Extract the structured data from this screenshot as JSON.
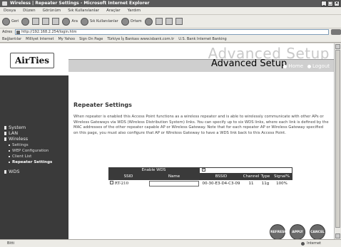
{
  "browser": {
    "title": "Wireless | Repeater Settings - Microsoft Internet Explorer",
    "menu": [
      "Dosya",
      "Düzen",
      "Görünüm",
      "Sık Kullanılanlar",
      "Araçlar",
      "Yardım"
    ],
    "toolbar": {
      "back": "Geri",
      "search": "Ara",
      "favorites": "Sık Kullanılanlar",
      "media": "Ortam"
    },
    "address_label": "Adres",
    "address": "http://192.168.2.254/login.htm",
    "links_label": "Bağlantılar",
    "links": [
      "Milliyet Internet",
      "My Yahoo",
      "Sign On Page",
      "Türkiye İş Bankası  www.isbank.com.tr",
      "U.S. Bank Internet Banking"
    ],
    "status_left": "Bitti",
    "status_right": "Internet"
  },
  "header": {
    "logo": "AirTies",
    "bg_text": "Advanced Setup",
    "title": "Advanced Setup",
    "home": "Home",
    "logout": "Logout"
  },
  "sidebar": {
    "groups": [
      "System",
      "LAN",
      "Wireless"
    ],
    "sub_items": [
      "Settings",
      "WEP Configuration",
      "Client List",
      "Repeater Settings"
    ],
    "extra": "WDS"
  },
  "content": {
    "title": "Repeater Settings",
    "description": "When repeater is enabled this Access Point functions as a wireless repeater and is able to wirelessly communicate with other APs or Wireless Gateways via WDS (Wireless Distribution System) links. You can specify up to six WDS links, where each link is defined by the MAC addresses of the other repeater capable AP or Wireless Gateway. Note that for each repeater AP or Wireless Gateway specified on this page, you must also configure that AP or Wireless Gateway to have a WDS link back to this Access Point."
  },
  "wds_table": {
    "enable_label": "Enable WDS",
    "enable_checked": true,
    "columns": [
      "SSID",
      "Name",
      "BSSID",
      "Channel",
      "Type",
      "Signal%"
    ],
    "rows": [
      {
        "ssid": "RT-210",
        "name": "",
        "bssid": "00-30-E3-D4-C3-09",
        "channel": "11",
        "type": "11g",
        "signal": "100%"
      }
    ]
  },
  "buttons": {
    "refresh": "REFRESH",
    "apply": "APPLY",
    "cancel": "CANCEL"
  }
}
